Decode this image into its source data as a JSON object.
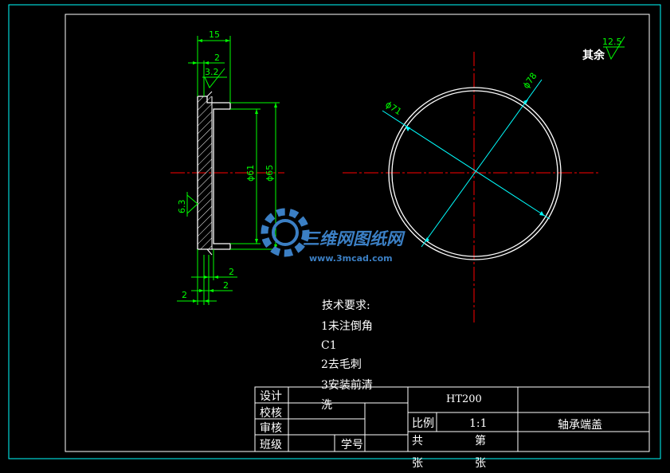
{
  "colors": {
    "background": "#000000",
    "frame": "#00ffff",
    "outline": "#ffffff",
    "dimension": "#00ff00",
    "centerline": "#ff0000",
    "leader": "#00ffff",
    "watermark": "#3b7fc4"
  },
  "section_view": {
    "dims": {
      "total_width": "15",
      "step_top": "2",
      "roughness_top": "3.2",
      "bore_dia": "ϕ61",
      "outer_dia": "ϕ65",
      "roughness_face": "6.3",
      "step_b1": "2",
      "step_b2": "2",
      "step_b3": "2"
    }
  },
  "front_view": {
    "dims": {
      "inner_dia": "ϕ71",
      "outer_dia": "ϕ78"
    }
  },
  "roughness_note": {
    "label": "其余",
    "value": "12.5"
  },
  "tech_requirements": {
    "title": "技术要求:",
    "lines": [
      "1未注倒角",
      "C1",
      "2去毛刺",
      "3安装前清",
      "洗"
    ]
  },
  "title_block": {
    "design": "设计",
    "check": "校核",
    "review": "审核",
    "class": "班级",
    "student_no": "学号",
    "material": "HT200",
    "scale_label": "比例",
    "scale_value": "1:1",
    "part_name": "轴承端盖",
    "total_label": "共",
    "sheet_label": "第",
    "zhang1": "张",
    "zhang2": "张"
  },
  "watermark": {
    "brand": "三维网图纸网",
    "url": "www.3mcad.com"
  }
}
